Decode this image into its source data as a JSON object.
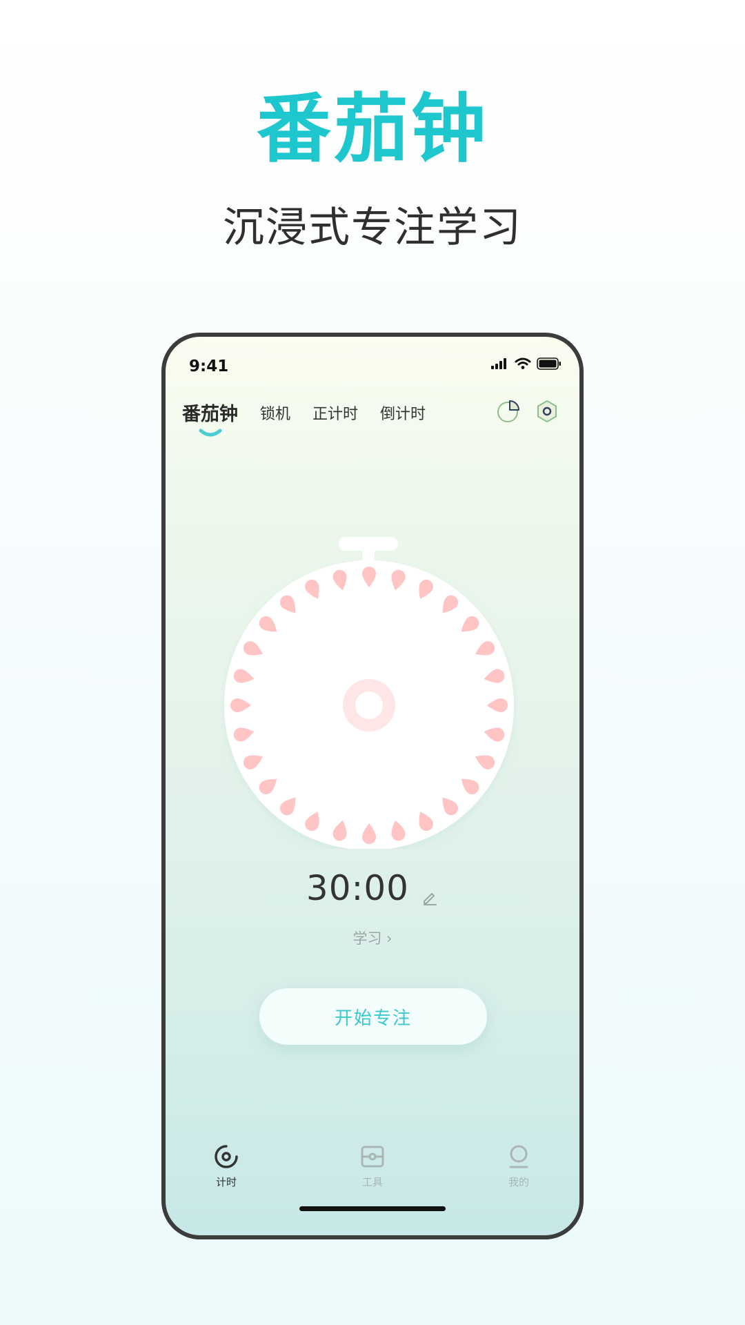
{
  "hero": {
    "title": "番茄钟",
    "subtitle": "沉浸式专注学习",
    "title_color": "#1ec6cd"
  },
  "status_bar": {
    "time": "9:41",
    "icons": [
      "cellular-signal-icon",
      "wifi-icon",
      "battery-icon"
    ]
  },
  "tabs": [
    {
      "label": "番茄钟",
      "active": true
    },
    {
      "label": "锁机",
      "active": false
    },
    {
      "label": "正计时",
      "active": false
    },
    {
      "label": "倒计时",
      "active": false
    }
  ],
  "header_icons": [
    "statistics-pie-icon",
    "settings-hex-icon"
  ],
  "timer": {
    "time": "30:00",
    "category": "学习 ›",
    "start_label": "开始专注"
  },
  "bottom_nav": [
    {
      "label": "计时",
      "icon": "timer-icon",
      "active": true
    },
    {
      "label": "工具",
      "icon": "toolbox-icon",
      "active": false
    },
    {
      "label": "我的",
      "icon": "profile-icon",
      "active": false
    }
  ],
  "colors": {
    "accent": "#3ac8cf",
    "petal": "#ffc4c4",
    "dial": "#ffffff",
    "inactive_nav": "#a9b6b6"
  }
}
